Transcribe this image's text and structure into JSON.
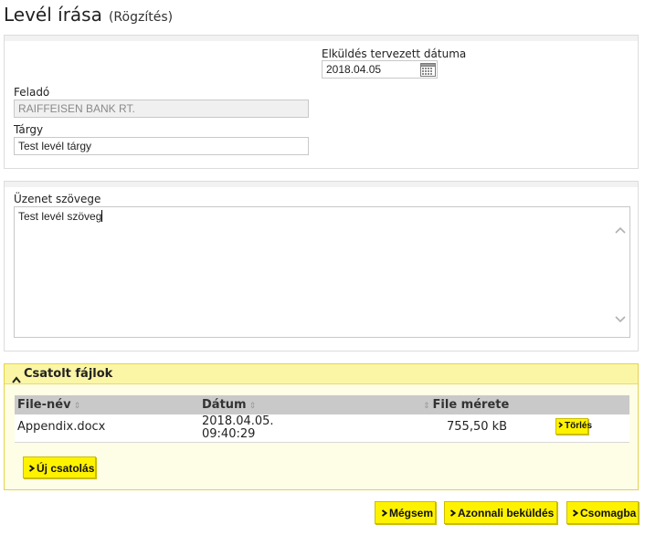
{
  "page": {
    "title": "Levél írása",
    "subtitle": "(Rögzítés)"
  },
  "form": {
    "send_date_label": "Elküldés tervezett dátuma",
    "send_date_value": "2018.04.05",
    "sender_label": "Feladó",
    "sender_value": "RAIFFEISEN BANK RT.",
    "subject_label": "Tárgy",
    "subject_value": "Test levél tárgy",
    "body_label": "Üzenet szövege",
    "body_value": "Test levél szöveg"
  },
  "attachments": {
    "header": "Csatolt fájlok",
    "columns": {
      "name": "File-név",
      "date": "Dátum",
      "size": "File mérete"
    },
    "rows": [
      {
        "name": "Appendix.docx",
        "date_line1": "2018.04.05.",
        "date_line2": "09:40:29",
        "size": "755,50 kB",
        "delete_label": "Törlés"
      }
    ],
    "new_attachment_label": "Új csatolás"
  },
  "footer": {
    "cancel_label": "Mégsem",
    "send_now_label": "Azonnali beküldés",
    "package_label": "Csomagba"
  },
  "colors": {
    "button_yellow": "#fff200",
    "attach_panel_bg": "#fefde6",
    "attach_header_bg": "#fbf6a6"
  },
  "icons": {
    "calendar": "calendar-icon",
    "chevron_right": "chevron-right-icon",
    "caret_up": "caret-up-icon",
    "sort": "sort-icon"
  }
}
